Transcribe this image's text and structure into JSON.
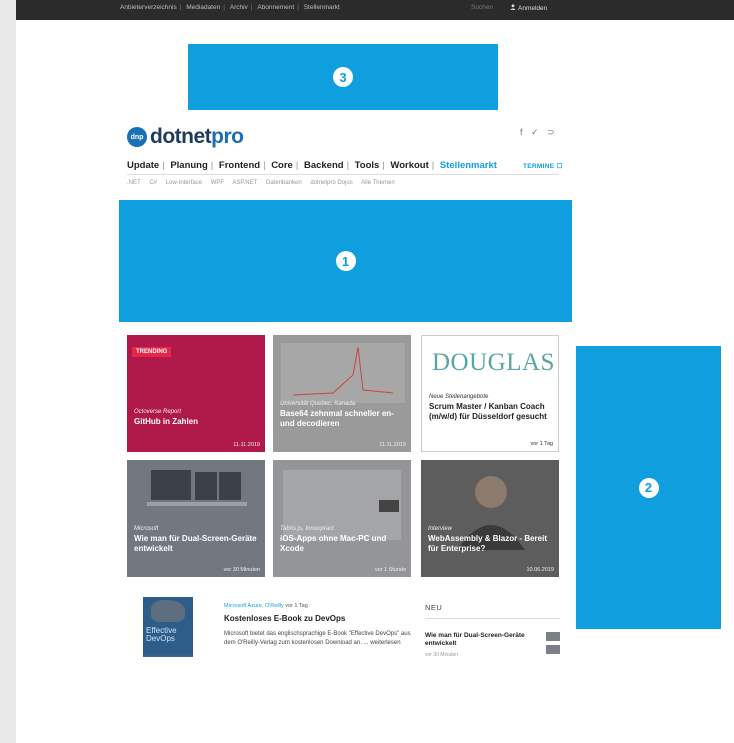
{
  "topbar": {
    "links": [
      "Anbieterverzeichnis",
      "Mediadaten",
      "Archiv",
      "Abonnement",
      "Stellenmarkt"
    ],
    "separator": "|",
    "search": "Suchen",
    "login": "Anmelden"
  },
  "ads": {
    "top": "3",
    "wide": "1",
    "side": "2"
  },
  "logo": {
    "badge": "dnp",
    "brand_a": "dotnet",
    "brand_b": "pro"
  },
  "social": "f ✓ ⊃",
  "nav": {
    "items": [
      "Update",
      "Planung",
      "Frontend",
      "Core",
      "Backend",
      "Tools",
      "Workout"
    ],
    "accent_item": "Stellenmarkt",
    "termine": "TERMINE ☐"
  },
  "subnav": [
    ".NET",
    "C#",
    "Low-Interface",
    "WPF",
    "ASP.NET",
    "Datenbanken",
    "dotnetpro Dojos",
    "Alle Themen"
  ],
  "tiles": [
    {
      "tag": "TRENDING",
      "kicker": "Octoverse Report",
      "title": "GitHub in Zahlen",
      "date": "11.11.2019"
    },
    {
      "kicker": "Universität Quebec, Kanada",
      "title": "Base64 zehnmal schneller en- und decodieren",
      "date": "11.11.2019"
    },
    {
      "brand": "DOUGLAS",
      "kicker": "Neue Stellenangebote",
      "title": "Scrum Master / Kanban Coach (m/w/d) für Düsseldorf gesucht",
      "date": "vor 1 Tag"
    },
    {
      "kicker": "Microsoft",
      "title": "Wie man für Dual-Screen-Geräte entwickelt",
      "date": "vor 30 Minuten"
    },
    {
      "kicker": "Tabris.js, Innoopract",
      "title": "iOS-Apps ohne Mac-PC und Xcode",
      "date": "vor 1 Stunde"
    },
    {
      "kicker": "Interview",
      "title": "WebAssembly & Blazor - Bereit für Enterprise?",
      "date": "10.06.2019"
    }
  ],
  "article": {
    "book_title": "Effective DevOps",
    "meta_accent": "Microsoft Azure, O'Reilly",
    "meta_time": "vor 1 Tag",
    "title": "Kostenloses E-Book zu DevOps",
    "text": "Microsoft bietet das englischsprachige E-Book \"Effective DevOps\" aus dem O'Reilly-Verlag zum kostenlosen Download an. ... weiterlesen"
  },
  "neu": {
    "heading": "NEU",
    "item": "Wie man für Dual-Screen-Geräte entwickelt",
    "meta": "vor 30 Minuten"
  }
}
